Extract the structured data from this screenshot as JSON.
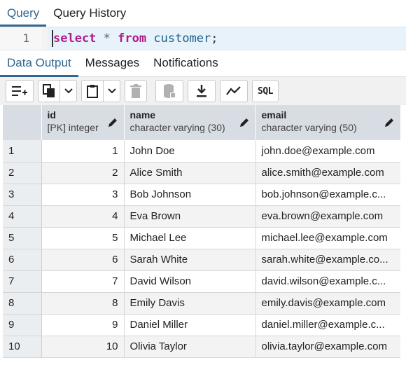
{
  "top_tabs": [
    {
      "label": "Query"
    },
    {
      "label": "Query History"
    }
  ],
  "editor": {
    "line_number": "1",
    "tokens": {
      "kw1": "select",
      "star": "*",
      "kw2": "from",
      "ident": "customer",
      "punct": ";"
    }
  },
  "result_tabs": [
    {
      "label": "Data Output"
    },
    {
      "label": "Messages"
    },
    {
      "label": "Notifications"
    }
  ],
  "toolbar": {
    "sql_label": "SQL",
    "icons": [
      "add-row-icon",
      "copy-icon",
      "chevron-down-icon",
      "paste-icon",
      "chevron-down-icon",
      "delete-icon",
      "save-data-icon",
      "download-icon",
      "graph-icon",
      "sql-icon"
    ]
  },
  "columns": [
    {
      "name": "id",
      "type": "[PK] integer"
    },
    {
      "name": "name",
      "type": "character varying (30)"
    },
    {
      "name": "email",
      "type": "character varying (50)"
    }
  ],
  "rows": [
    {
      "n": "1",
      "id": "1",
      "name": "John Doe",
      "email": "john.doe@example.com"
    },
    {
      "n": "2",
      "id": "2",
      "name": "Alice Smith",
      "email": "alice.smith@example.com"
    },
    {
      "n": "3",
      "id": "3",
      "name": "Bob Johnson",
      "email": "bob.johnson@example.c..."
    },
    {
      "n": "4",
      "id": "4",
      "name": "Eva Brown",
      "email": "eva.brown@example.com"
    },
    {
      "n": "5",
      "id": "5",
      "name": "Michael Lee",
      "email": "michael.lee@example.com"
    },
    {
      "n": "6",
      "id": "6",
      "name": "Sarah White",
      "email": "sarah.white@example.co..."
    },
    {
      "n": "7",
      "id": "7",
      "name": "David Wilson",
      "email": "david.wilson@example.c..."
    },
    {
      "n": "8",
      "id": "8",
      "name": "Emily Davis",
      "email": "emily.davis@example.com"
    },
    {
      "n": "9",
      "id": "9",
      "name": "Daniel Miller",
      "email": "daniel.miller@example.c..."
    },
    {
      "n": "10",
      "id": "10",
      "name": "Olivia Taylor",
      "email": "olivia.taylor@example.com"
    }
  ],
  "colors": {
    "accent": "#326690",
    "keyword": "#b01b8a",
    "identifier": "#1b5f86",
    "header_bg": "#d8dde3"
  }
}
